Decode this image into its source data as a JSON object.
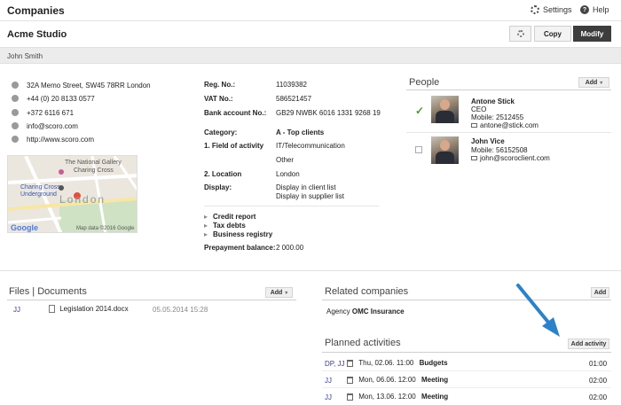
{
  "topbar": {
    "title": "Companies",
    "settings_label": "Settings",
    "help_label": "Help"
  },
  "company": {
    "name": "Acme Studio"
  },
  "actions": {
    "copy_label": "Copy",
    "modify_label": "Modify"
  },
  "contact_person": "John Smith",
  "contact": {
    "address": "32A Memo Street, SW45 78RR London",
    "phone": "+44 (0) 20 8133 0577",
    "mobile": "+372 6116 671",
    "email": "info@scoro.com",
    "web": "http://www.scoro.com"
  },
  "map": {
    "labels": [
      "The National Gallery",
      "Charing Cross",
      "Charing Cross Underground",
      "London"
    ],
    "footer": "Map data ©2016 Google",
    "logo": "Google"
  },
  "details": {
    "reg_no_label": "Reg. No.:",
    "reg_no": "11039382",
    "vat_no_label": "VAT No.:",
    "vat_no": "586521457",
    "bank_label": "Bank account No.:",
    "bank": "GB29 NWBK 6016 1331 9268 19",
    "category_label": "Category:",
    "category": "A - Top clients",
    "field_label": "1. Field of activity",
    "field_1": "IT/Telecommunication",
    "field_2": "Other",
    "location_label": "2. Location",
    "location": "London",
    "display_label": "Display:",
    "display_1": "Display in client list",
    "display_2": "Display in supplier list",
    "expand_items": [
      "Credit report",
      "Tax debts",
      "Business registry"
    ],
    "prepayment_label": "Prepayment balance:",
    "prepayment": "2 000.00"
  },
  "people": {
    "title": "People",
    "add_label": "Add",
    "list": [
      {
        "name": "Antone Stick",
        "role": "CEO",
        "mobile": "Mobile: 2512455",
        "email": "antone@stick.com"
      },
      {
        "name": "John Vice",
        "mobile": "Mobile: 56152508",
        "email": "john@scoroclient.com"
      }
    ]
  },
  "files": {
    "title": "Files | Documents",
    "add_label": "Add",
    "rows": [
      {
        "initials": "JJ",
        "name": "Legislation 2014.docx",
        "date": "05.05.2014 15:28"
      }
    ]
  },
  "related": {
    "title": "Related companies",
    "add_label": "Add",
    "type": "Agency",
    "company": "OMC Insurance"
  },
  "planned": {
    "title": "Planned activities",
    "add_label": "Add activity",
    "rows": [
      {
        "initials": "DP, JJ",
        "date": "Thu, 02.06. 11:00",
        "name": "Budgets",
        "duration": "01:00"
      },
      {
        "initials": "JJ",
        "date": "Mon, 06.06. 12:00",
        "name": "Meeting",
        "duration": "02:00"
      },
      {
        "initials": "JJ",
        "date": "Mon, 13.06. 12:00",
        "name": "Meeting",
        "duration": "02:00"
      }
    ]
  },
  "colors": {
    "accent_arrow": "#2b82c9",
    "initials": "#3a3f8f",
    "modify_button": "#3d3d3d"
  }
}
